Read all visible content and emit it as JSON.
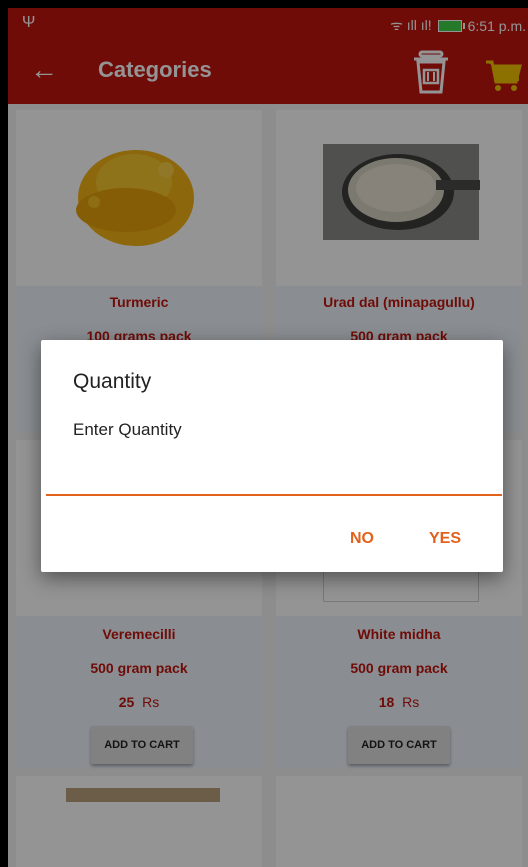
{
  "status_bar": {
    "time": "6:51 p.m.",
    "signal": "ᯤ ıll ıl!"
  },
  "toolbar": {
    "title": "Categories",
    "back_icon": "arrow-left-icon",
    "trash_icon": "trash-icon",
    "cart_icon": "cart-icon"
  },
  "products": [
    {
      "name": "Turmeric",
      "pack": "100 grams pack"
    },
    {
      "name": "Urad dal (minapagullu)",
      "pack": "500 gram pack"
    },
    {
      "name": "Veremecilli",
      "pack": "500 gram pack",
      "price": "25",
      "currency": "Rs",
      "button": "ADD TO CART"
    },
    {
      "name": "White midha",
      "pack": "500 gram pack",
      "price": "18",
      "currency": "Rs",
      "button": "ADD TO CART"
    }
  ],
  "dialog": {
    "title": "Quantity",
    "message": "Enter Quantity",
    "input_value": "",
    "no_label": "NO",
    "yes_label": "YES"
  },
  "colors": {
    "primary": "#c0150f",
    "accent": "#e2621b"
  }
}
